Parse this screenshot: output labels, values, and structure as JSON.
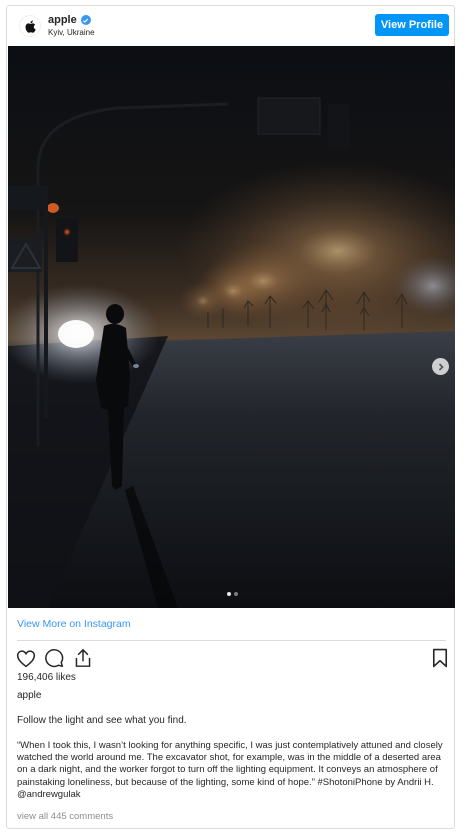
{
  "header": {
    "username": "apple",
    "location": "Kyiv, Ukraine",
    "view_profile_label": "View Profile"
  },
  "carousel": {
    "current": 1,
    "total": 2
  },
  "view_more_label": "View More on Instagram",
  "likes": "196,406 likes",
  "poster": "apple",
  "caption_short": "Follow the light and see what you find.",
  "caption_long": "“When I took this, I wasn’t looking for anything specific, I was just contemplatively attuned and closely watched the world around me. The excavator shot, for example, was in the middle of a deserted area on a dark night, and the worker forgot to turn off the lighting equipment. It conveys an atmosphere of painstaking loneliness, but because of the lighting, some kind of hope.” #ShotoniPhone by Andrii H. @andrewgulak",
  "comments_label": "view all 445 comments",
  "colors": {
    "accent": "#0095f6",
    "link": "#3897f0",
    "muted": "#8e8e8e"
  },
  "icons": [
    "apple-logo-icon",
    "verified-badge-icon",
    "chevron-right-icon",
    "heart-icon",
    "comment-icon",
    "share-icon",
    "bookmark-icon"
  ]
}
